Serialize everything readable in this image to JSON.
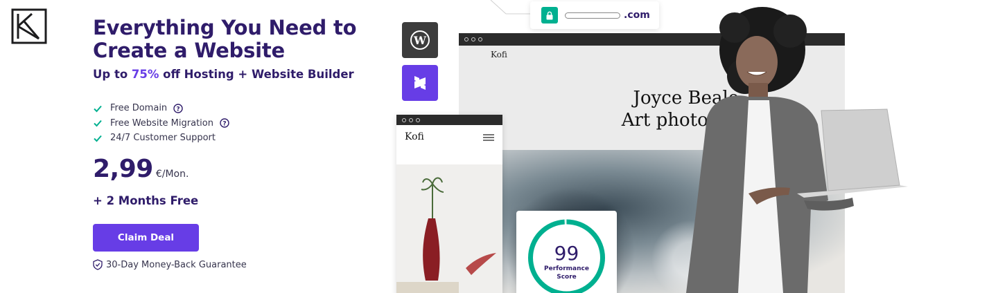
{
  "hero": {
    "title_line1": "Everything You Need to",
    "title_line2": "Create a Website",
    "subtitle_prefix": "Up to ",
    "subtitle_accent": "75%",
    "subtitle_suffix": " off Hosting + Website Builder"
  },
  "features": [
    {
      "label": "Free Domain",
      "has_help": true
    },
    {
      "label": "Free Website Migration",
      "has_help": true
    },
    {
      "label": "24/7 Customer Support",
      "has_help": false
    }
  ],
  "pricing": {
    "price": "2,99",
    "period": "€/Mon.",
    "bonus": "+ 2 Months Free"
  },
  "cta": {
    "label": "Claim Deal"
  },
  "guarantee": {
    "text": "30-Day Money-Back Guarantee"
  },
  "visual": {
    "domain_tld": ".com",
    "site_brand": "Kofi",
    "headline_line1": "Joyce Beale,",
    "headline_line2": "Art photograpl",
    "mobile_brand": "Kofi",
    "score_value": "99",
    "score_label_line1": "Performance",
    "score_label_line2": "Score",
    "score_fraction": 0.99
  },
  "colors": {
    "brand": "#673de6",
    "heading": "#2f1c6a",
    "check": "#00b090",
    "score_ring": "#00b090"
  },
  "icons": [
    "brand-logo-icon",
    "check-icon",
    "help-icon",
    "shield-icon",
    "lock-icon",
    "wordpress-icon",
    "website-builder-icon",
    "menu-icon"
  ]
}
